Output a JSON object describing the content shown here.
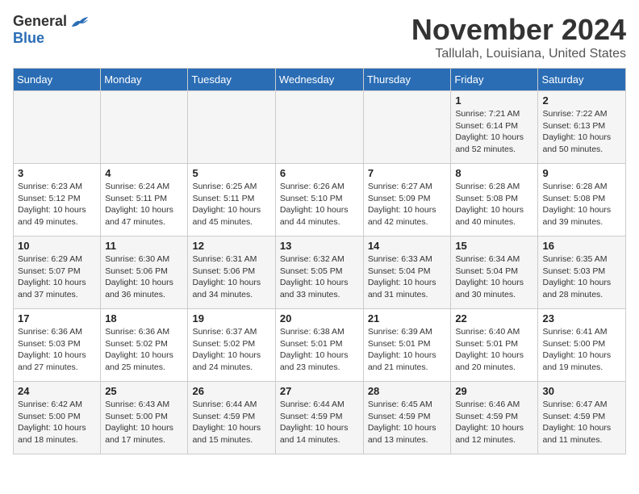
{
  "header": {
    "logo_general": "General",
    "logo_blue": "Blue",
    "month": "November 2024",
    "location": "Tallulah, Louisiana, United States"
  },
  "weekdays": [
    "Sunday",
    "Monday",
    "Tuesday",
    "Wednesday",
    "Thursday",
    "Friday",
    "Saturday"
  ],
  "weeks": [
    [
      {
        "day": "",
        "sunrise": "",
        "sunset": "",
        "daylight": ""
      },
      {
        "day": "",
        "sunrise": "",
        "sunset": "",
        "daylight": ""
      },
      {
        "day": "",
        "sunrise": "",
        "sunset": "",
        "daylight": ""
      },
      {
        "day": "",
        "sunrise": "",
        "sunset": "",
        "daylight": ""
      },
      {
        "day": "",
        "sunrise": "",
        "sunset": "",
        "daylight": ""
      },
      {
        "day": "1",
        "sunrise": "Sunrise: 7:21 AM",
        "sunset": "Sunset: 6:14 PM",
        "daylight": "Daylight: 10 hours and 52 minutes."
      },
      {
        "day": "2",
        "sunrise": "Sunrise: 7:22 AM",
        "sunset": "Sunset: 6:13 PM",
        "daylight": "Daylight: 10 hours and 50 minutes."
      }
    ],
    [
      {
        "day": "3",
        "sunrise": "Sunrise: 6:23 AM",
        "sunset": "Sunset: 5:12 PM",
        "daylight": "Daylight: 10 hours and 49 minutes."
      },
      {
        "day": "4",
        "sunrise": "Sunrise: 6:24 AM",
        "sunset": "Sunset: 5:11 PM",
        "daylight": "Daylight: 10 hours and 47 minutes."
      },
      {
        "day": "5",
        "sunrise": "Sunrise: 6:25 AM",
        "sunset": "Sunset: 5:11 PM",
        "daylight": "Daylight: 10 hours and 45 minutes."
      },
      {
        "day": "6",
        "sunrise": "Sunrise: 6:26 AM",
        "sunset": "Sunset: 5:10 PM",
        "daylight": "Daylight: 10 hours and 44 minutes."
      },
      {
        "day": "7",
        "sunrise": "Sunrise: 6:27 AM",
        "sunset": "Sunset: 5:09 PM",
        "daylight": "Daylight: 10 hours and 42 minutes."
      },
      {
        "day": "8",
        "sunrise": "Sunrise: 6:28 AM",
        "sunset": "Sunset: 5:08 PM",
        "daylight": "Daylight: 10 hours and 40 minutes."
      },
      {
        "day": "9",
        "sunrise": "Sunrise: 6:28 AM",
        "sunset": "Sunset: 5:08 PM",
        "daylight": "Daylight: 10 hours and 39 minutes."
      }
    ],
    [
      {
        "day": "10",
        "sunrise": "Sunrise: 6:29 AM",
        "sunset": "Sunset: 5:07 PM",
        "daylight": "Daylight: 10 hours and 37 minutes."
      },
      {
        "day": "11",
        "sunrise": "Sunrise: 6:30 AM",
        "sunset": "Sunset: 5:06 PM",
        "daylight": "Daylight: 10 hours and 36 minutes."
      },
      {
        "day": "12",
        "sunrise": "Sunrise: 6:31 AM",
        "sunset": "Sunset: 5:06 PM",
        "daylight": "Daylight: 10 hours and 34 minutes."
      },
      {
        "day": "13",
        "sunrise": "Sunrise: 6:32 AM",
        "sunset": "Sunset: 5:05 PM",
        "daylight": "Daylight: 10 hours and 33 minutes."
      },
      {
        "day": "14",
        "sunrise": "Sunrise: 6:33 AM",
        "sunset": "Sunset: 5:04 PM",
        "daylight": "Daylight: 10 hours and 31 minutes."
      },
      {
        "day": "15",
        "sunrise": "Sunrise: 6:34 AM",
        "sunset": "Sunset: 5:04 PM",
        "daylight": "Daylight: 10 hours and 30 minutes."
      },
      {
        "day": "16",
        "sunrise": "Sunrise: 6:35 AM",
        "sunset": "Sunset: 5:03 PM",
        "daylight": "Daylight: 10 hours and 28 minutes."
      }
    ],
    [
      {
        "day": "17",
        "sunrise": "Sunrise: 6:36 AM",
        "sunset": "Sunset: 5:03 PM",
        "daylight": "Daylight: 10 hours and 27 minutes."
      },
      {
        "day": "18",
        "sunrise": "Sunrise: 6:36 AM",
        "sunset": "Sunset: 5:02 PM",
        "daylight": "Daylight: 10 hours and 25 minutes."
      },
      {
        "day": "19",
        "sunrise": "Sunrise: 6:37 AM",
        "sunset": "Sunset: 5:02 PM",
        "daylight": "Daylight: 10 hours and 24 minutes."
      },
      {
        "day": "20",
        "sunrise": "Sunrise: 6:38 AM",
        "sunset": "Sunset: 5:01 PM",
        "daylight": "Daylight: 10 hours and 23 minutes."
      },
      {
        "day": "21",
        "sunrise": "Sunrise: 6:39 AM",
        "sunset": "Sunset: 5:01 PM",
        "daylight": "Daylight: 10 hours and 21 minutes."
      },
      {
        "day": "22",
        "sunrise": "Sunrise: 6:40 AM",
        "sunset": "Sunset: 5:01 PM",
        "daylight": "Daylight: 10 hours and 20 minutes."
      },
      {
        "day": "23",
        "sunrise": "Sunrise: 6:41 AM",
        "sunset": "Sunset: 5:00 PM",
        "daylight": "Daylight: 10 hours and 19 minutes."
      }
    ],
    [
      {
        "day": "24",
        "sunrise": "Sunrise: 6:42 AM",
        "sunset": "Sunset: 5:00 PM",
        "daylight": "Daylight: 10 hours and 18 minutes."
      },
      {
        "day": "25",
        "sunrise": "Sunrise: 6:43 AM",
        "sunset": "Sunset: 5:00 PM",
        "daylight": "Daylight: 10 hours and 17 minutes."
      },
      {
        "day": "26",
        "sunrise": "Sunrise: 6:44 AM",
        "sunset": "Sunset: 4:59 PM",
        "daylight": "Daylight: 10 hours and 15 minutes."
      },
      {
        "day": "27",
        "sunrise": "Sunrise: 6:44 AM",
        "sunset": "Sunset: 4:59 PM",
        "daylight": "Daylight: 10 hours and 14 minutes."
      },
      {
        "day": "28",
        "sunrise": "Sunrise: 6:45 AM",
        "sunset": "Sunset: 4:59 PM",
        "daylight": "Daylight: 10 hours and 13 minutes."
      },
      {
        "day": "29",
        "sunrise": "Sunrise: 6:46 AM",
        "sunset": "Sunset: 4:59 PM",
        "daylight": "Daylight: 10 hours and 12 minutes."
      },
      {
        "day": "30",
        "sunrise": "Sunrise: 6:47 AM",
        "sunset": "Sunset: 4:59 PM",
        "daylight": "Daylight: 10 hours and 11 minutes."
      }
    ]
  ]
}
